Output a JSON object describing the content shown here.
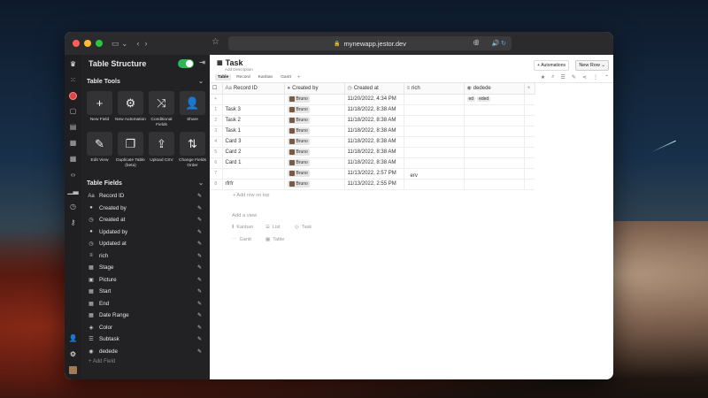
{
  "browser": {
    "url": "mynewapp.jestor.dev"
  },
  "panel": {
    "title": "Table Structure",
    "tools_title": "Table Tools",
    "tools": [
      {
        "label": "New Field",
        "icon": "+"
      },
      {
        "label": "New Automation",
        "icon": "⚙"
      },
      {
        "label": "Conditional Fields",
        "icon": "⤨"
      },
      {
        "label": "Share",
        "icon": "👤"
      },
      {
        "label": "Edit View",
        "icon": "✎"
      },
      {
        "label": "Duplicate Table (beta)",
        "icon": "❐"
      },
      {
        "label": "Upload CSV",
        "icon": "⇪"
      },
      {
        "label": "Change Fields Order",
        "icon": "⇅"
      }
    ],
    "fields_title": "Table Fields",
    "fields": [
      {
        "label": "Record ID",
        "icon": "Aa"
      },
      {
        "label": "Created by",
        "icon": "●"
      },
      {
        "label": "Created at",
        "icon": "◷"
      },
      {
        "label": "Updated by",
        "icon": "●"
      },
      {
        "label": "Updated at",
        "icon": "◷"
      },
      {
        "label": "rich",
        "icon": "≡"
      },
      {
        "label": "Stage",
        "icon": "▦"
      },
      {
        "label": "Picture",
        "icon": "▣"
      },
      {
        "label": "Start",
        "icon": "▦"
      },
      {
        "label": "End",
        "icon": "▦"
      },
      {
        "label": "Date Range",
        "icon": "▦"
      },
      {
        "label": "Color",
        "icon": "◈"
      },
      {
        "label": "Subtask",
        "icon": "☰"
      },
      {
        "label": "dedede",
        "icon": "◉"
      }
    ],
    "add_field": "+ Add Field"
  },
  "main": {
    "title": "Task",
    "subtitle": "Add Description",
    "automations_label": "+ Automations",
    "new_row_label": "New Row",
    "views": [
      "Table",
      "Record",
      "Kanban",
      "Gantt"
    ],
    "columns": [
      "Record ID",
      "Created by",
      "Created at",
      "rich",
      "dedede"
    ],
    "rows": [
      {
        "num": "+",
        "id": "",
        "by": "Bruno",
        "at": "11/20/2022, 4:34 PM",
        "rich": "",
        "tags": [
          "ed",
          "eded"
        ]
      },
      {
        "num": "1",
        "id": "Task 3",
        "by": "Bruno",
        "at": "11/18/2022, 8:38 AM",
        "rich": "",
        "tags": []
      },
      {
        "num": "2",
        "id": "Task 2",
        "by": "Bruno",
        "at": "11/18/2022, 8:38 AM",
        "rich": "",
        "tags": []
      },
      {
        "num": "3",
        "id": "Task 1",
        "by": "Bruno",
        "at": "11/18/2022, 8:38 AM",
        "rich": "",
        "tags": []
      },
      {
        "num": "4",
        "id": "Card 3",
        "by": "Bruno",
        "at": "11/18/2022, 8:38 AM",
        "rich": "",
        "tags": []
      },
      {
        "num": "5",
        "id": "Card 2",
        "by": "Bruno",
        "at": "11/18/2022, 8:38 AM",
        "rich": "",
        "tags": []
      },
      {
        "num": "6",
        "id": "Card 1",
        "by": "Bruno",
        "at": "11/18/2022, 8:38 AM",
        "rich": "",
        "tags": []
      },
      {
        "num": "7",
        "id": "",
        "by": "Bruno",
        "at": "11/13/2022, 2:57 PM",
        "rich": "erv",
        "tags": []
      },
      {
        "num": "8",
        "id": "rfrfr",
        "by": "Bruno",
        "at": "11/13/2022, 2:55 PM",
        "rich": "",
        "tags": []
      }
    ],
    "add_row_top": "+ Add row on top",
    "add_view_title": "Add a view",
    "add_view_options": [
      "Kanban",
      "List",
      "Task",
      "Gantt",
      "Table"
    ]
  },
  "colors": {
    "accent_green": "#2eb85c",
    "dark_panel": "#222224"
  }
}
